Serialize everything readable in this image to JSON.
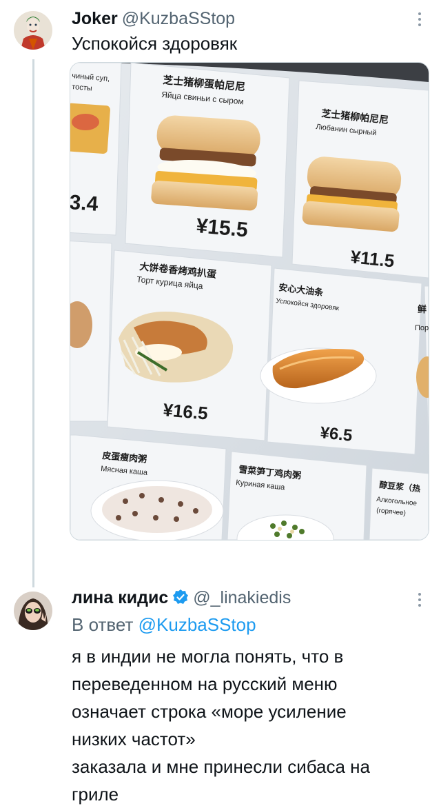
{
  "tweet": {
    "author_name": "Joker",
    "author_handle": "@KuzbaSStop",
    "text": "Успокойся здоровяк",
    "menu": {
      "items": [
        {
          "cn": "芝士猪柳蛋帕尼尼",
          "ru": "Яйца свиньи с сыром",
          "price": "¥15.5"
        },
        {
          "cn": "芝士猪柳帕尼尼",
          "ru": "Любанин сырный",
          "price": "¥11.5"
        },
        {
          "cn": "大饼卷香烤鸡扒蛋",
          "ru": "Торт курица яйца",
          "price": "¥16.5"
        },
        {
          "cn": "安心大油条",
          "ru": "Успокойся здоровяк",
          "price": "¥6.5"
        },
        {
          "cn": "皮蛋瘦肉粥",
          "ru": "Мясная каша",
          "price": ""
        },
        {
          "cn": "雪菜笋丁鸡肉粥",
          "ru": "Куриная каша",
          "price": ""
        },
        {
          "cn": "醇豆浆（热",
          "ru": "Алкогольное",
          "ru2": "(горячее)",
          "price": ""
        }
      ],
      "edge_left_top": "чиный суп,",
      "edge_left_top2": "тосты",
      "edge_left_price": "3.4",
      "edge_right_cn": "鲜",
      "edge_right_ru": "Пор"
    }
  },
  "reply": {
    "author_name": "лина кидис",
    "author_handle": "@_linakiedis",
    "reply_prefix": "В ответ",
    "reply_to": "@KuzbaSStop",
    "lines": [
      "я в индии не могла понять, что в",
      "переведенном на русский меню",
      "означает строка «море усиление",
      "низких частот»",
      "заказала и мне принесли сибаса на",
      "гриле"
    ]
  },
  "colors": {
    "link": "#1d9bf0",
    "verified": "#1d9bf0",
    "muted": "#536471"
  }
}
